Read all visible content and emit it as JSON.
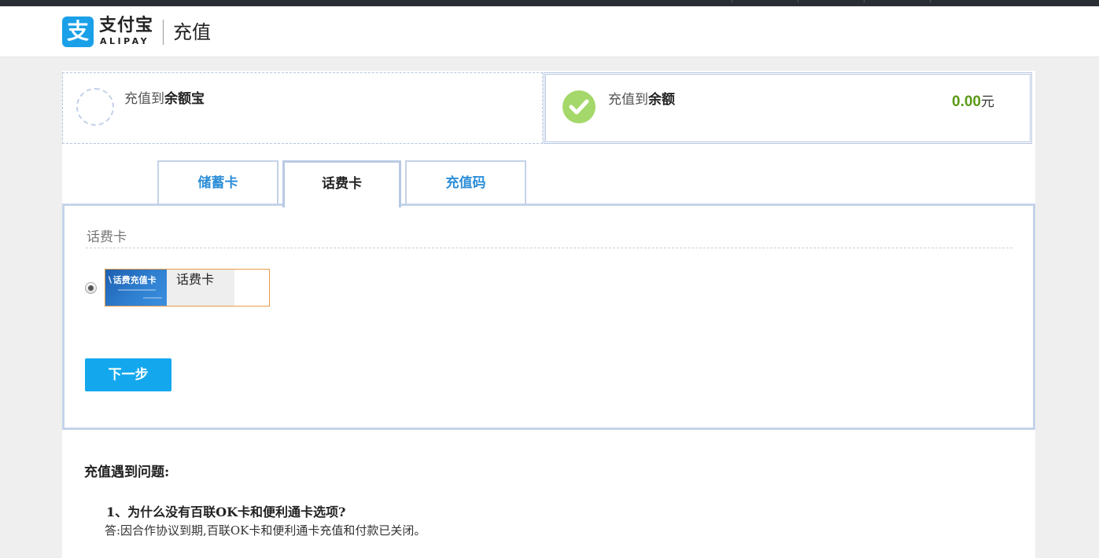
{
  "header": {
    "logo_glyph": "支",
    "logo_text": "支付宝",
    "logo_sub": "ALIPAY",
    "page_title": "充值"
  },
  "targets": {
    "yuebao": {
      "prefix": "充值到",
      "name": "余额宝"
    },
    "balance": {
      "prefix": "充值到",
      "name": "余额",
      "amount": "0.00",
      "unit": "元"
    }
  },
  "tabs": [
    {
      "label": "储蓄卡",
      "active": false
    },
    {
      "label": "话费卡",
      "active": true
    },
    {
      "label": "充值码",
      "active": false
    }
  ],
  "panel": {
    "section_title": "话费卡",
    "card": {
      "image_text": "话费充值卡",
      "name": "话费卡",
      "selected": true
    },
    "next_label": "下一步"
  },
  "faq": {
    "title": "充值遇到问题:",
    "items": [
      {
        "question": "1、为什么没有百联OK卡和便利通卡选项?",
        "answer": "答:因合作协议到期,百联OK卡和便利通卡充值和付款已关闭。"
      }
    ]
  },
  "colors": {
    "brand": "#1aa0e8",
    "tab_link": "#2c8ed8",
    "balance_green": "#5b9a16",
    "check_green": "#a5d86a",
    "button_blue": "#13a8ee",
    "card_border": "#e99b48"
  },
  "icons": {
    "logo": "alipay-logo-icon",
    "selected": "check-icon",
    "unselected": "dashed-circle-icon"
  }
}
